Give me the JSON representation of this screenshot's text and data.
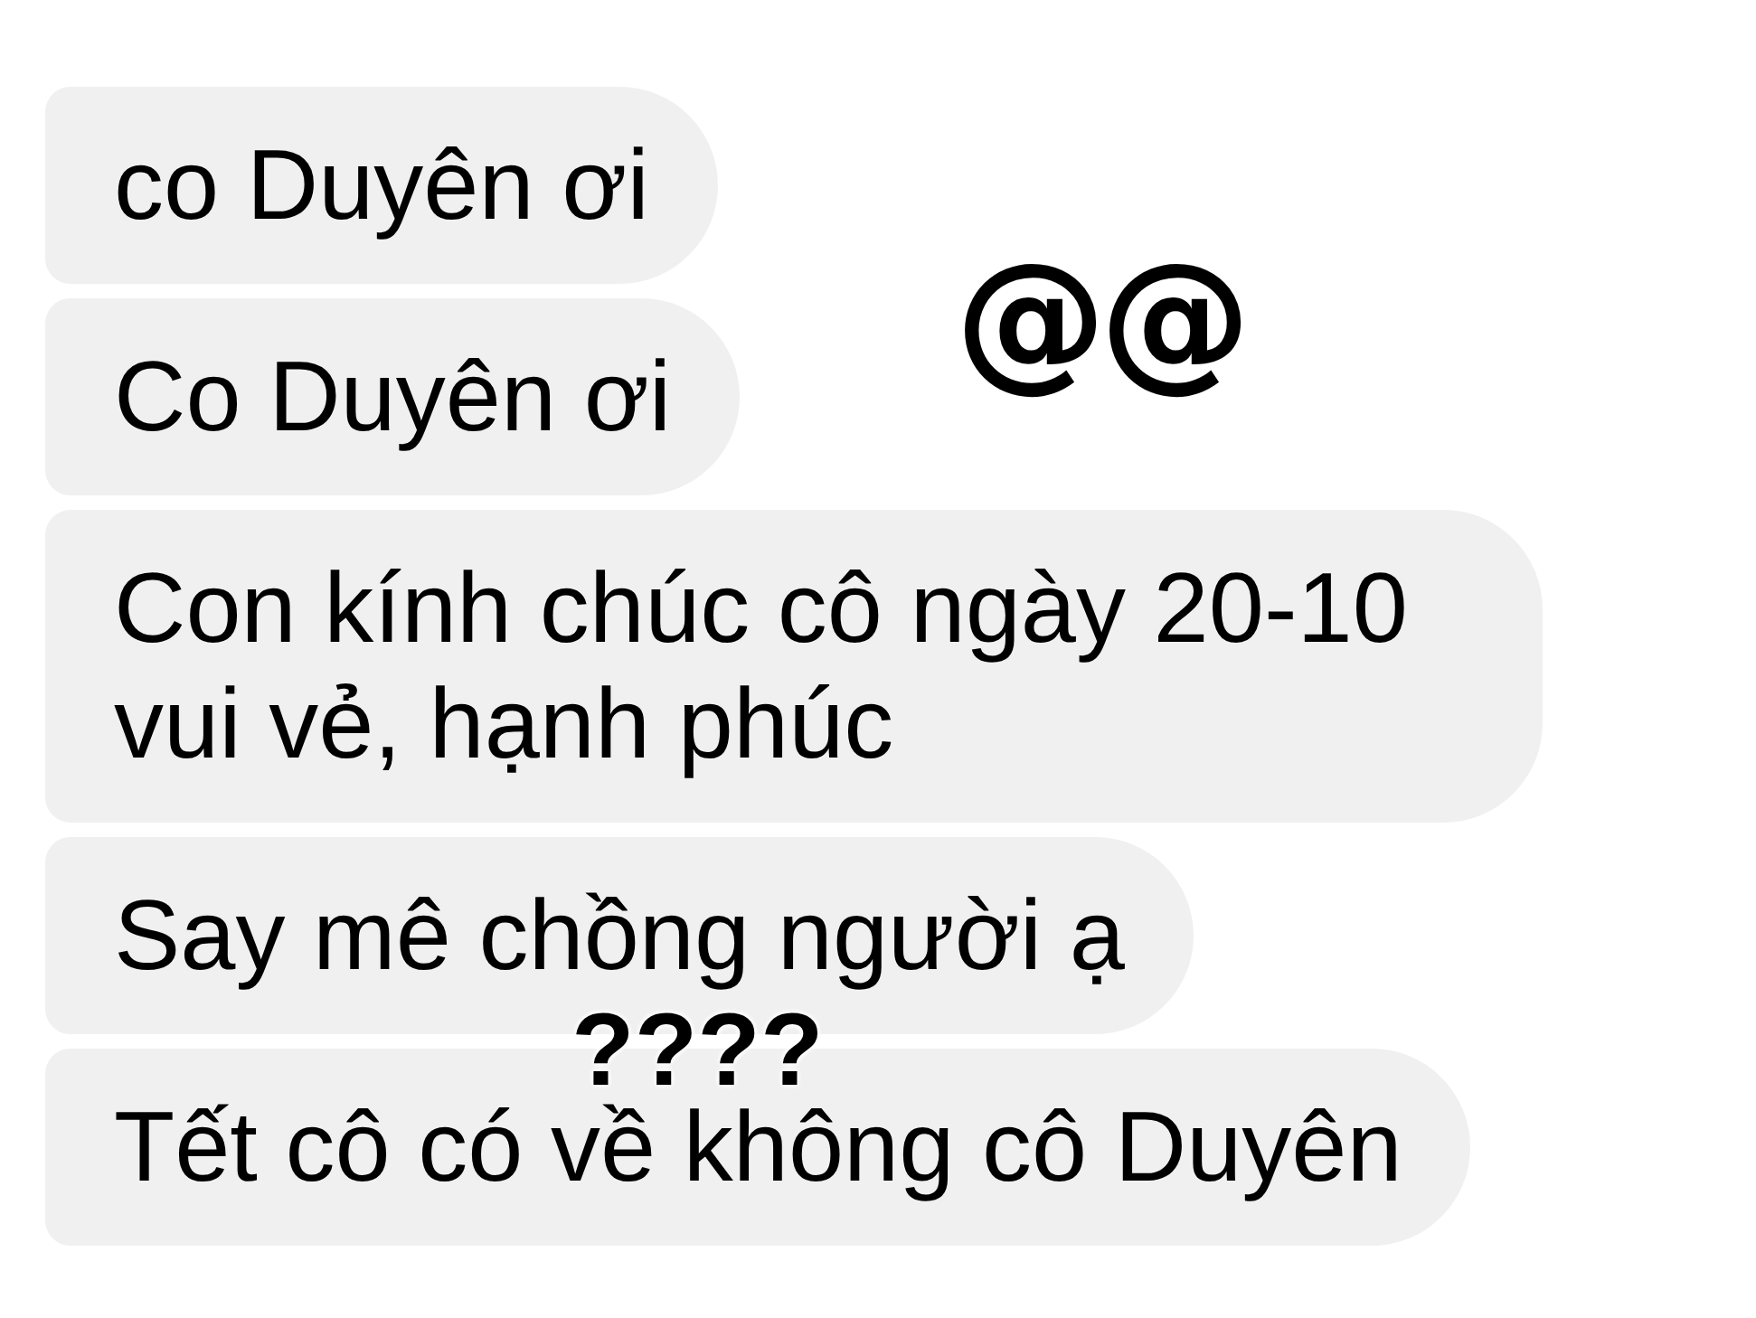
{
  "messages": [
    {
      "text": "co Duyên ơi"
    },
    {
      "text": "Co Duyên ơi"
    },
    {
      "text": "Con kính chúc cô ngày 20-10 vui vẻ, hạnh phúc"
    },
    {
      "text": "Say mê chồng người ạ"
    },
    {
      "text": "Tết cô có về không cô Duyên"
    }
  ],
  "annotations": [
    {
      "text": "@@"
    },
    {
      "text": "????"
    }
  ]
}
